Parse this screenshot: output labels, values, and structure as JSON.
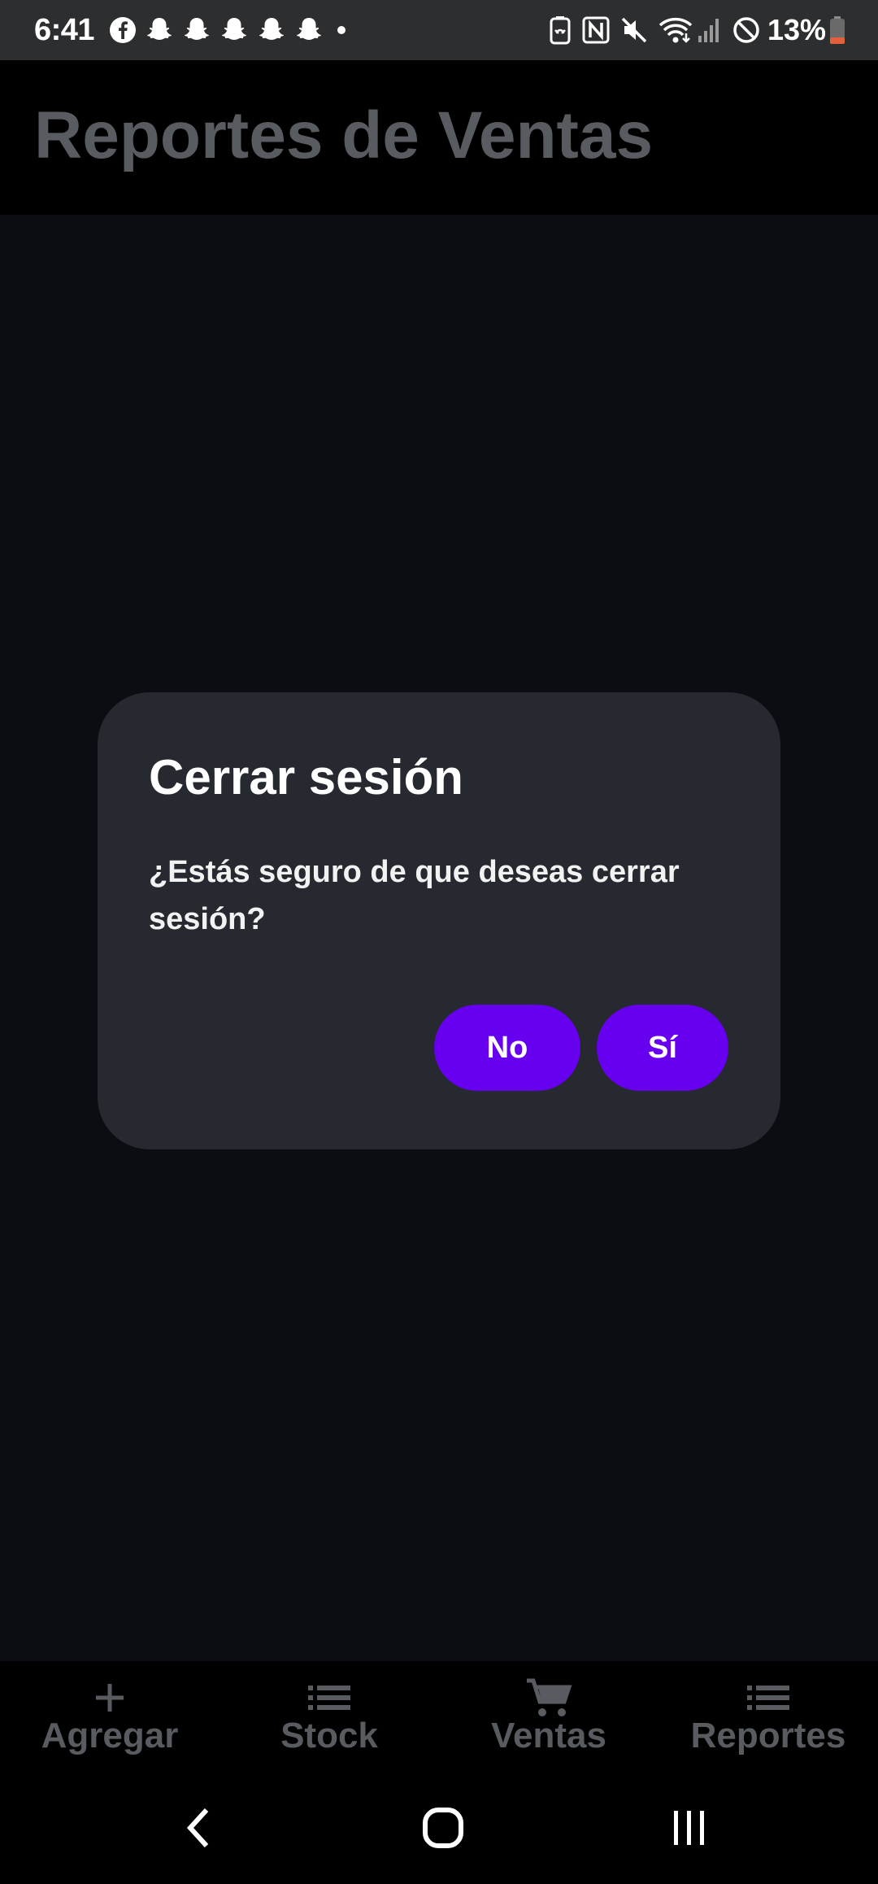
{
  "status_bar": {
    "time": "6:41",
    "left_icons": [
      "facebook-icon",
      "snapchat-icon",
      "snapchat-icon",
      "snapchat-icon",
      "snapchat-icon",
      "snapchat-icon",
      "more-dot-icon"
    ],
    "right_icons": [
      "battery-saver-icon",
      "nfc-icon",
      "mute-icon",
      "wifi-icon",
      "signal-icon",
      "do-not-disturb-icon"
    ],
    "battery_text": "13%",
    "battery_color": "#e2603a"
  },
  "app_bar": {
    "title": "Reportes de Ventas"
  },
  "dialog": {
    "title": "Cerrar sesión",
    "message": "¿Estás seguro de que deseas cerrar sesión?",
    "buttons": {
      "no_label": "No",
      "yes_label": "Sí"
    },
    "accent_color": "#6600ee"
  },
  "bottom_nav": {
    "items": [
      {
        "label": "Agregar",
        "icon": "plus-icon"
      },
      {
        "label": "Stock",
        "icon": "list-icon"
      },
      {
        "label": "Ventas",
        "icon": "cart-icon"
      },
      {
        "label": "Reportes",
        "icon": "list-icon"
      }
    ]
  },
  "system_nav": {
    "buttons": [
      "back-icon",
      "home-icon",
      "recents-icon"
    ]
  }
}
